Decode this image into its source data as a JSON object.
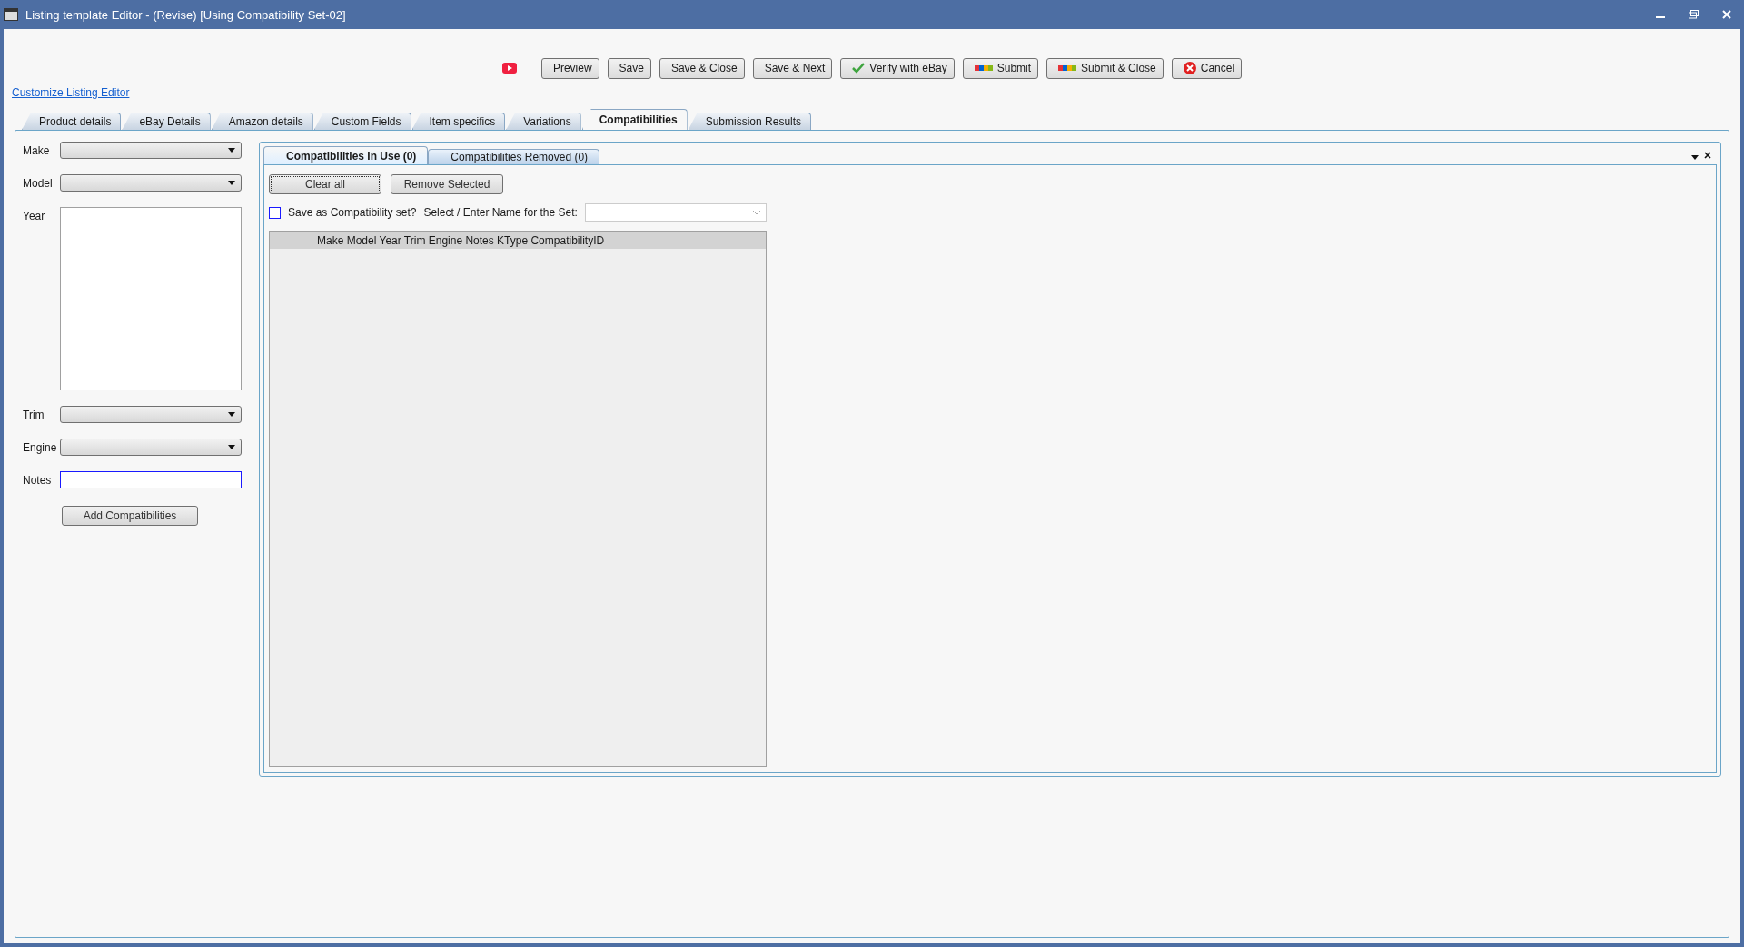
{
  "window": {
    "title": "Listing template Editor - (Revise) [Using Compatibility Set-02]"
  },
  "toolbar": [
    {
      "label": "Preview",
      "kind": "plain"
    },
    {
      "label": "Save",
      "kind": "plain"
    },
    {
      "label": "Save & Close",
      "kind": "plain"
    },
    {
      "label": "Save & Next",
      "kind": "plain"
    },
    {
      "label": "Verify with eBay",
      "kind": "check"
    },
    {
      "label": "Submit",
      "kind": "ebay"
    },
    {
      "label": "Submit & Close",
      "kind": "ebay"
    },
    {
      "label": "Cancel",
      "kind": "cancel"
    }
  ],
  "customize_link": "Customize Listing Editor",
  "tabs": [
    {
      "label": "Product details",
      "selected": false
    },
    {
      "label": "eBay Details",
      "selected": false
    },
    {
      "label": "Amazon details",
      "selected": false
    },
    {
      "label": "Custom Fields",
      "selected": false
    },
    {
      "label": "Item specifics",
      "selected": false
    },
    {
      "label": "Variations",
      "selected": false
    },
    {
      "label": "Compatibilities",
      "selected": true
    },
    {
      "label": "Submission Results",
      "selected": false
    }
  ],
  "filters": [
    {
      "label": "Make",
      "kind": "combo"
    },
    {
      "label": "Model",
      "kind": "combo"
    },
    {
      "label": "Year",
      "kind": "list"
    },
    {
      "label": "Trim",
      "kind": "combo"
    },
    {
      "label": "Engine",
      "kind": "combo"
    },
    {
      "label": "Notes",
      "kind": "text",
      "focused": true
    }
  ],
  "add_button": "Add Compatibilities",
  "inner_tabs": [
    {
      "label": "Compatibilities In Use (0)",
      "selected": true
    },
    {
      "label": "Compatibilities Removed (0)",
      "selected": false
    }
  ],
  "actions": [
    {
      "label": "Clear all",
      "focused": true
    },
    {
      "label": "Remove Selected",
      "focused": false
    }
  ],
  "save_set": {
    "label": "Save as Compatibility set?",
    "checked": false
  },
  "set_name_label": "Select / Enter Name for the Set:",
  "grid": {
    "header": "Make Model Year Trim Engine Notes KType CompatibilityID"
  }
}
